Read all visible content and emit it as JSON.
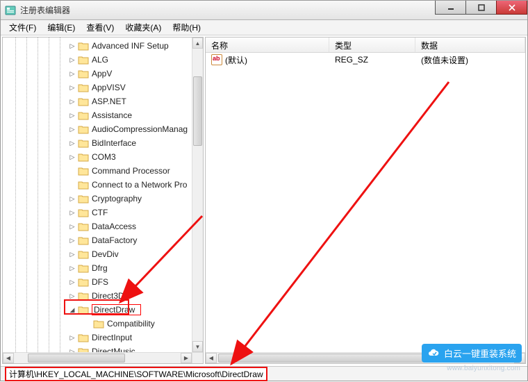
{
  "window": {
    "title": "注册表编辑器"
  },
  "menu": {
    "file": "文件(F)",
    "edit": "编辑(E)",
    "view": "查看(V)",
    "favorites": "收藏夹(A)",
    "help": "帮助(H)"
  },
  "tree": {
    "items": [
      {
        "label": "Advanced INF Setup",
        "toggle": "▷"
      },
      {
        "label": "ALG",
        "toggle": "▷"
      },
      {
        "label": "AppV",
        "toggle": "▷"
      },
      {
        "label": "AppVISV",
        "toggle": "▷"
      },
      {
        "label": "ASP.NET",
        "toggle": "▷"
      },
      {
        "label": "Assistance",
        "toggle": "▷"
      },
      {
        "label": "AudioCompressionManag",
        "toggle": "▷"
      },
      {
        "label": "BidInterface",
        "toggle": "▷"
      },
      {
        "label": "COM3",
        "toggle": "▷"
      },
      {
        "label": "Command Processor",
        "toggle": ""
      },
      {
        "label": "Connect to a Network Pro",
        "toggle": ""
      },
      {
        "label": "Cryptography",
        "toggle": "▷"
      },
      {
        "label": "CTF",
        "toggle": "▷"
      },
      {
        "label": "DataAccess",
        "toggle": "▷"
      },
      {
        "label": "DataFactory",
        "toggle": "▷"
      },
      {
        "label": "DevDiv",
        "toggle": "▷"
      },
      {
        "label": "Dfrg",
        "toggle": "▷"
      },
      {
        "label": "DFS",
        "toggle": "▷"
      },
      {
        "label": "Direct3D",
        "toggle": "▷"
      },
      {
        "label": "DirectDraw",
        "toggle": "◢",
        "selected": true
      },
      {
        "label": "Compatibility",
        "toggle": "",
        "child": true
      },
      {
        "label": "DirectInput",
        "toggle": "▷"
      },
      {
        "label": "DirectMusic",
        "toggle": "▷"
      }
    ]
  },
  "list": {
    "headers": {
      "name": "名称",
      "type": "类型",
      "data": "数据"
    },
    "rows": [
      {
        "name": "(默认)",
        "type": "REG_SZ",
        "data": "(数值未设置)"
      }
    ]
  },
  "statusbar": {
    "path": "计算机\\HKEY_LOCAL_MACHINE\\SOFTWARE\\Microsoft\\DirectDraw"
  },
  "watermark": {
    "brand": "白云一键重装系统",
    "url": "www.baiyunxitong.com"
  }
}
